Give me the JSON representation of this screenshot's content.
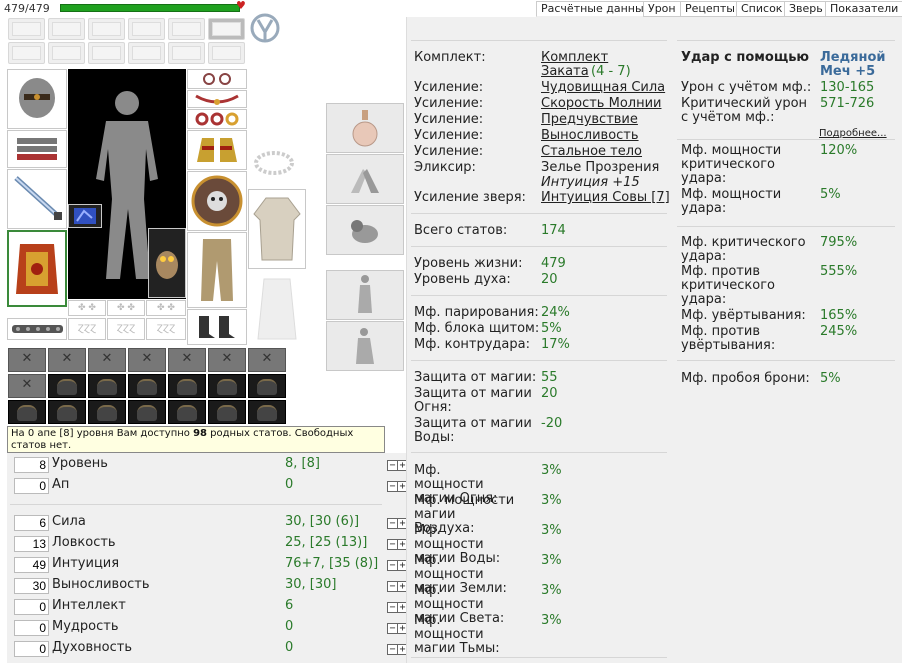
{
  "header": {
    "hp": "479/479"
  },
  "tabs": [
    "Расчётные данные",
    "Урон",
    "Рецепты",
    "Список",
    "Зверь",
    "Показатели"
  ],
  "tooltip": {
    "prefix": "На 0 апе [8] уровня Вам доступно ",
    "count": "98",
    "suffix": " родных статов. Свободных статов нет."
  },
  "stats_top": [
    {
      "input": "8",
      "label": "Уровень",
      "value": "8, [8]"
    },
    {
      "input": "0",
      "label": "Ап",
      "value": "0"
    }
  ],
  "stats": [
    {
      "input": "6",
      "label": "Сила",
      "value": "30, [30 (6)]"
    },
    {
      "input": "13",
      "label": "Ловкость",
      "value": "25, [25 (13)]"
    },
    {
      "input": "49",
      "label": "Интуиция",
      "value": "76+7, [35 (8)]"
    },
    {
      "input": "30",
      "label": "Выносливость",
      "value": "30, [30]"
    },
    {
      "input": "0",
      "label": "Интеллект",
      "value": "6"
    },
    {
      "input": "0",
      "label": "Мудрость",
      "value": "0"
    },
    {
      "input": "0",
      "label": "Духовность",
      "value": "0"
    }
  ],
  "buffs": {
    "komplekt_label": "Комплект:",
    "komplekt_value": "Комплект Заката",
    "komplekt_range": "(4 - 7)",
    "usil_label": "Усиление:",
    "usil": [
      "Чудовищная Сила",
      "Скорость Молнии",
      "Предчувствие",
      "Выносливость",
      "Стальное тело"
    ],
    "elixir_label": "Эликсир:",
    "elixir_value": "Зелье Прозрения",
    "elixir_effect": "Интуиция +15",
    "beast_label": "Усиление зверя:",
    "beast_value": "Интуиция Совы [7]"
  },
  "totals": {
    "label": "Всего статов:",
    "value": "174"
  },
  "life": [
    {
      "label": "Уровень жизни:",
      "value": "479"
    },
    {
      "label": "Уровень духа:",
      "value": "20"
    }
  ],
  "parry": [
    {
      "label": "Мф. парирования:",
      "value": "24%"
    },
    {
      "label": "Мф. блока щитом:",
      "value": "5%"
    },
    {
      "label": "Мф. контрудара:",
      "value": "17%"
    }
  ],
  "magic_def": [
    {
      "label": "Защита от магии:",
      "value": "55"
    },
    {
      "label": "Защита от магии Огня:",
      "value": "20"
    },
    {
      "label": "Защита от магии Воды:",
      "value": "-20"
    }
  ],
  "magic_pow": [
    {
      "label": "Мф. мощности магии Огня:",
      "value": "3%"
    },
    {
      "label": "Мф. мощности магии Воздуха:",
      "value": "3%"
    },
    {
      "label": "Мф. мощности магии Воды:",
      "value": "3%"
    },
    {
      "label": "Мф. мощности магии Земли:",
      "value": "3%"
    },
    {
      "label": "Мф. мощности магии Света:",
      "value": "3%"
    },
    {
      "label": "Мф. мощности магии Тьмы:",
      "value": "3%"
    }
  ],
  "weapon": {
    "head_label": "Удар с помощью",
    "head_value": "Ледяной Меч +5",
    "dmg_label": "Урон с учётом мф.:",
    "dmg_value": "130-165",
    "crit_label": "Критический урон с учётом мф.:",
    "crit_value": "571-726",
    "more": "Подробнее...",
    "rows1": [
      {
        "label": "Мф. мощности критического удара:",
        "value": "120%"
      },
      {
        "label": "Мф. мощности удара:",
        "value": "5%"
      }
    ],
    "rows2": [
      {
        "label": "Мф. критического удара:",
        "value": "795%"
      },
      {
        "label": "Мф. против критического удара:",
        "value": "555%"
      },
      {
        "label": "Мф. увёртывания:",
        "value": "165%"
      },
      {
        "label": "Мф. против увёртывания:",
        "value": "245%"
      }
    ],
    "pierce_label": "Мф. пробоя брони:",
    "pierce_value": "5%"
  },
  "colors": {
    "green": "#2a7a2a",
    "blue": "#3a6a9a",
    "panel": "#f0f0f0",
    "hp": "#1fa11f"
  }
}
